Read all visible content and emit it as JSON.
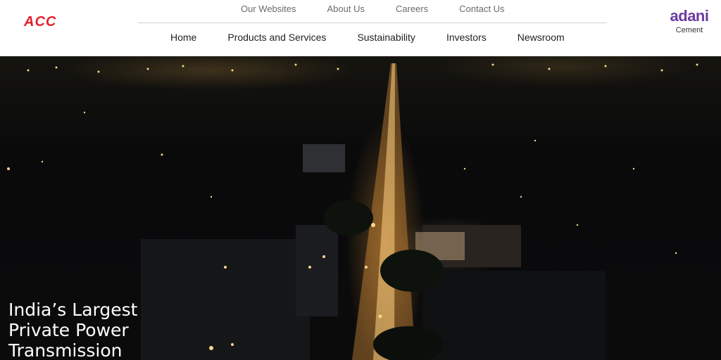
{
  "header": {
    "logo_text": "ACC",
    "top_links": [
      "Our Websites",
      "About Us",
      "Careers",
      "Contact Us"
    ],
    "main_nav": [
      "Home",
      "Products and Services",
      "Sustainability",
      "Investors",
      "Newsroom"
    ],
    "partner_logo_word": "adani",
    "partner_logo_sub": "Cement"
  },
  "hero": {
    "title_lines": [
      "India’s Largest",
      "Private Power",
      "Transmission"
    ]
  },
  "colors": {
    "acc_red": "#e3202c",
    "adani_purple": "#6d3aa0",
    "adani_blue": "#3a6cc5"
  }
}
